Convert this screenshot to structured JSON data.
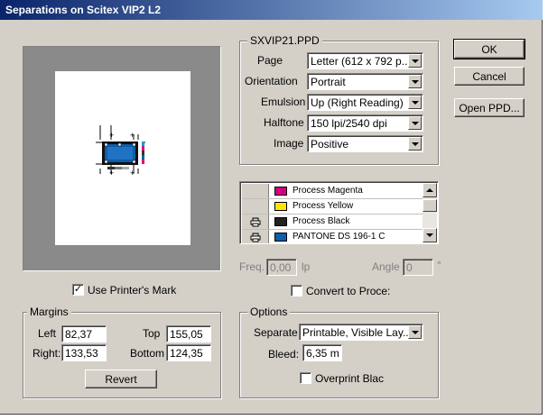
{
  "window": {
    "title": "Separations on Scitex VIP2 L2"
  },
  "buttons": {
    "ok": "OK",
    "cancel": "Cancel",
    "open_ppd": "Open PPD...",
    "revert": "Revert"
  },
  "ppd": {
    "legend": "SXVIP21.PPD",
    "fields": [
      {
        "label": "Page",
        "value": "Letter (612 x 792 p..."
      },
      {
        "label": "Orientation",
        "value": "Portrait"
      },
      {
        "label": "Emulsion",
        "value": "Up (Right Reading)"
      },
      {
        "label": "Halftone",
        "value": "150 lpi/2540 dpi"
      },
      {
        "label": "Image",
        "value": "Positive"
      }
    ]
  },
  "inks": [
    {
      "print_icon": "",
      "name": "Process Magenta",
      "color": "#d4007a"
    },
    {
      "print_icon": "",
      "name": "Process Yellow",
      "color": "#ffe600"
    },
    {
      "print_icon": "printer-icon",
      "name": "Process Black",
      "color": "#222222"
    },
    {
      "print_icon": "printer-icon",
      "name": "PANTONE DS 196-1 C",
      "color": "#0b5ea8"
    }
  ],
  "screen": {
    "freq_label": "Freq.",
    "freq_value": "0,00",
    "freq_unit": "lp",
    "angle_label": "Angle",
    "angle_value": "0",
    "angle_unit": "°"
  },
  "use_printers_marks": {
    "label": "Use Printer's Mark",
    "checked": true,
    "mark": "✓"
  },
  "convert_to_process": {
    "label": "Convert to Proce:",
    "checked": false,
    "mark": ""
  },
  "margins": {
    "legend": "Margins",
    "left_label": "Left",
    "left_value": "82,37",
    "top_label": "Top",
    "top_value": "155,05",
    "right_label": "Right:",
    "right_value": "133,53",
    "bottom_label": "Bottom",
    "bottom_value": "124,35"
  },
  "options": {
    "legend": "Options",
    "separate_label": "Separate",
    "separate_value": "Printable, Visible Lay...",
    "bleed_label": "Bleed:",
    "bleed_value": "6,35 m",
    "overprint_label": "Overprint Blac",
    "overprint_checked": false,
    "overprint_mark": ""
  },
  "colors": {
    "title_start": "#0a246a",
    "title_end": "#a6caf0",
    "dialog_bg": "#d4d0c8",
    "preview_bg": "#8a8a8a",
    "art_blue": "#0b5ea8"
  }
}
